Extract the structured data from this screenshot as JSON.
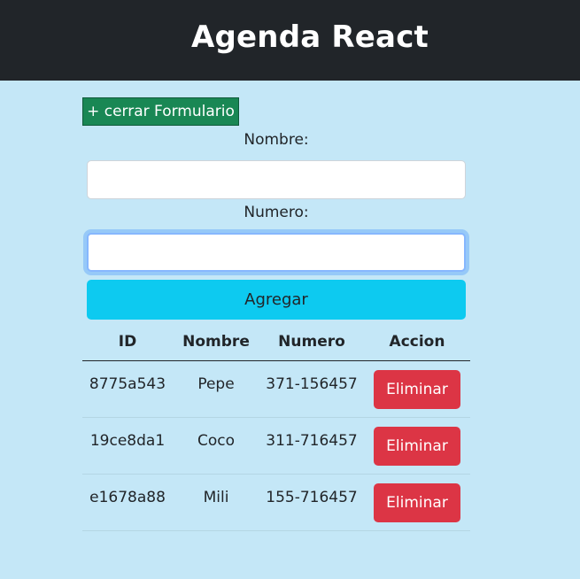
{
  "header": {
    "title": "Agenda React"
  },
  "form": {
    "toggle_label": "+ cerrar Formulario",
    "nombre_label": "Nombre:",
    "nombre_value": "",
    "numero_label": "Numero:",
    "numero_value": "",
    "submit_label": "Agregar"
  },
  "table": {
    "headers": [
      "ID",
      "Nombre",
      "Numero",
      "Accion"
    ],
    "rows": [
      {
        "id": "8775a543",
        "nombre": "Pepe",
        "numero": "371-156457",
        "action": "Eliminar"
      },
      {
        "id": "19ce8da1",
        "nombre": "Coco",
        "numero": "311-716457",
        "action": "Eliminar"
      },
      {
        "id": "e1678a88",
        "nombre": "Mili",
        "numero": "155-716457",
        "action": "Eliminar"
      }
    ]
  },
  "colors": {
    "navbar": "#212529",
    "page_background": "#c4e7f7",
    "toggle_button": "#198754",
    "submit_button": "#0dcaf0",
    "delete_button": "#dc3545"
  }
}
